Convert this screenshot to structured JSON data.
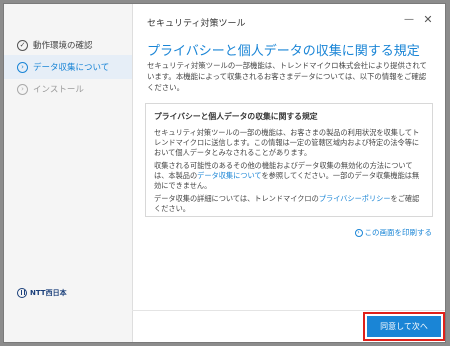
{
  "window": {
    "title": "セキュリティ対策ツール",
    "minimize_glyph": "—",
    "close_glyph": "✕"
  },
  "sidebar": {
    "steps": [
      {
        "label": "動作環境の確認",
        "icon": "check-icon",
        "glyph": "✓",
        "state": "done"
      },
      {
        "label": "データ収集について",
        "icon": "chevron-right-icon",
        "glyph": "›",
        "state": "active"
      },
      {
        "label": "インストール",
        "icon": "chevron-right-icon",
        "glyph": "›",
        "state": "pending"
      }
    ],
    "brand": "NTT西日本"
  },
  "main": {
    "title": "プライバシーと個人データの収集に関する規定",
    "intro": "セキュリティ対策ツールの一部機能は、トレンドマイクロ株式会社により提供されています。本機能によって収集されるお客さまデータについては、以下の情報をご確認ください。",
    "box": {
      "heading": "プライバシーと個人データの収集に関する規定",
      "p1": "セキュリティ対策ツールの一部の機能は、お客さまの製品の利用状況を収集してトレンドマイクロに送信します。この情報は一定の管轄区域内および特定の法令等において個人データとみなされることがあります。",
      "p2_a": "収集される可能性のあるその他の機能およびデータ収集の無効化の方法については、本製品の",
      "p2_link": "データ収集について",
      "p2_b": "を参照してください。一部のデータ収集機能は無効にできません。",
      "p3_a": "データ収集の詳細については、トレンドマイクロの",
      "p3_link": "プライバシーポリシー",
      "p3_b": "をご確認ください。"
    },
    "print_link": "この画面を印刷する",
    "next_button": "同意して次へ"
  },
  "colors": {
    "accent": "#1a85d6",
    "highlight": "#e0201a",
    "brand": "#1a3f7a"
  }
}
